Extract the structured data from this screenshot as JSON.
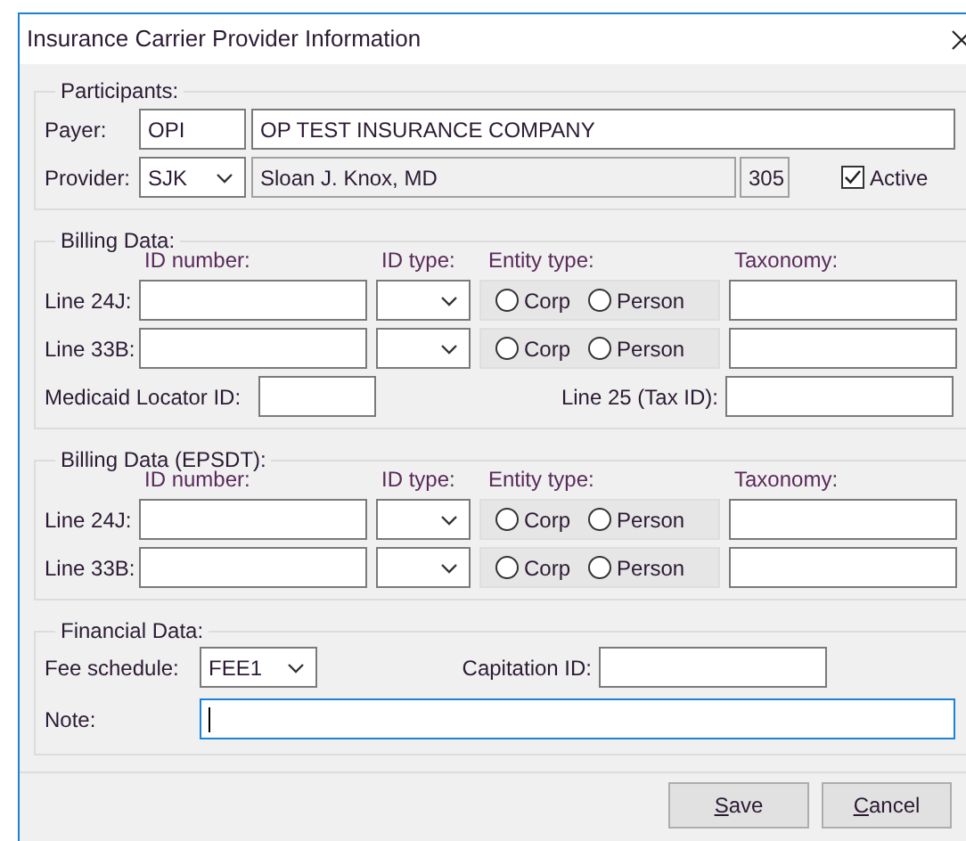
{
  "window": {
    "title": "Insurance Carrier Provider Information"
  },
  "participants": {
    "title": "Participants:",
    "payer": {
      "label": "Payer:",
      "code": "OPI",
      "name": "OP TEST INSURANCE COMPANY"
    },
    "provider": {
      "label": "Provider:",
      "code": "SJK",
      "name": "Sloan J. Knox, MD",
      "number": "305"
    },
    "active": {
      "label": "Active",
      "checked": true
    }
  },
  "billing_sections": [
    {
      "title": "Billing Data:",
      "headers": [
        "ID number:",
        "ID type:",
        "Entity type:",
        "Taxonomy:"
      ],
      "rows": [
        {
          "label": "Line 24J:",
          "entity_options": [
            {
              "label": "Corp",
              "selected": false
            },
            {
              "label": "Person",
              "selected": false
            }
          ]
        },
        {
          "label": "Line 33B:",
          "entity_options": [
            {
              "label": "Corp",
              "selected": false
            },
            {
              "label": "Person",
              "selected": false
            }
          ]
        }
      ],
      "extra": {
        "medicaid_label": "Medicaid Locator ID:",
        "tax_label": "Line 25 (Tax ID):"
      }
    },
    {
      "title": "Billing Data (EPSDT):",
      "headers": [
        "ID number:",
        "ID type:",
        "Entity type:",
        "Taxonomy:"
      ],
      "rows": [
        {
          "label": "Line 24J:",
          "entity_options": [
            {
              "label": "Corp",
              "selected": false
            },
            {
              "label": "Person",
              "selected": false
            }
          ]
        },
        {
          "label": "Line 33B:",
          "entity_options": [
            {
              "label": "Corp",
              "selected": false
            },
            {
              "label": "Person",
              "selected": false
            }
          ]
        }
      ]
    }
  ],
  "financial": {
    "title": "Financial Data:",
    "fee_label": "Fee schedule:",
    "fee_value": "FEE1",
    "capitation_label": "Capitation ID:",
    "note_label": "Note:",
    "note_focused": true
  },
  "buttons": [
    {
      "label": "Save"
    },
    {
      "label": "Cancel"
    }
  ]
}
